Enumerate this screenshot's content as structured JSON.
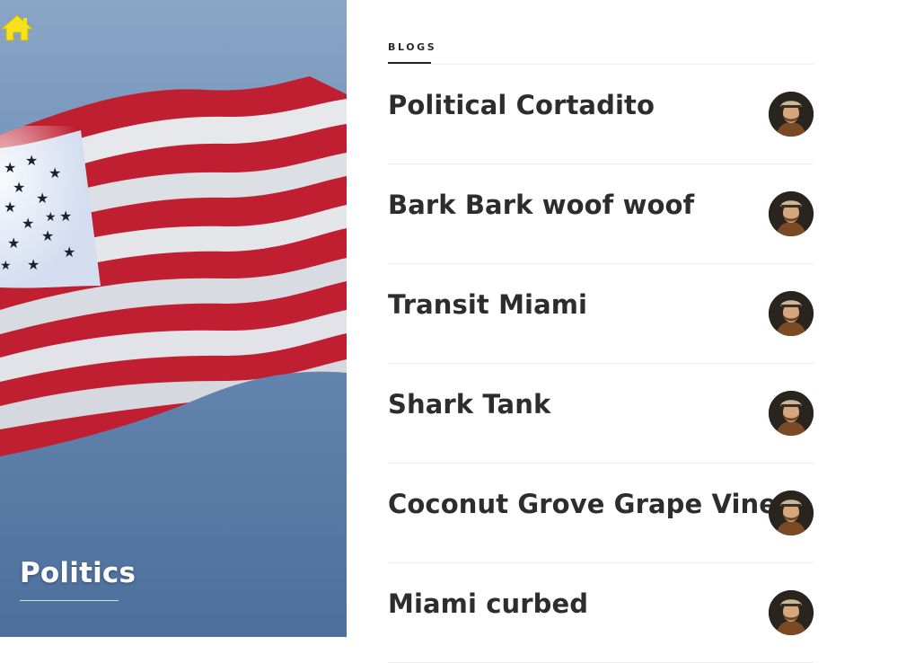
{
  "hero": {
    "title": "Politics",
    "home_icon": "home-icon",
    "home_icon_color": "#f5e21d"
  },
  "section": {
    "label": "BLOGS"
  },
  "blogs": [
    {
      "title": "Political Cortadito",
      "avatar_icon": "author-avatar"
    },
    {
      "title": "Bark Bark woof woof",
      "avatar_icon": "author-avatar"
    },
    {
      "title": "Transit Miami",
      "avatar_icon": "author-avatar"
    },
    {
      "title": "Shark Tank",
      "avatar_icon": "author-avatar"
    },
    {
      "title": "Coconut Grove Grape Vine",
      "avatar_icon": "author-avatar"
    },
    {
      "title": "Miami curbed",
      "avatar_icon": "author-avatar"
    }
  ],
  "colors": {
    "title_text": "#2d2d2d",
    "divider": "#ececec",
    "flag_red": "#b8202f",
    "flag_white": "#e9eaee",
    "flag_blue": "#c9d6ea"
  }
}
